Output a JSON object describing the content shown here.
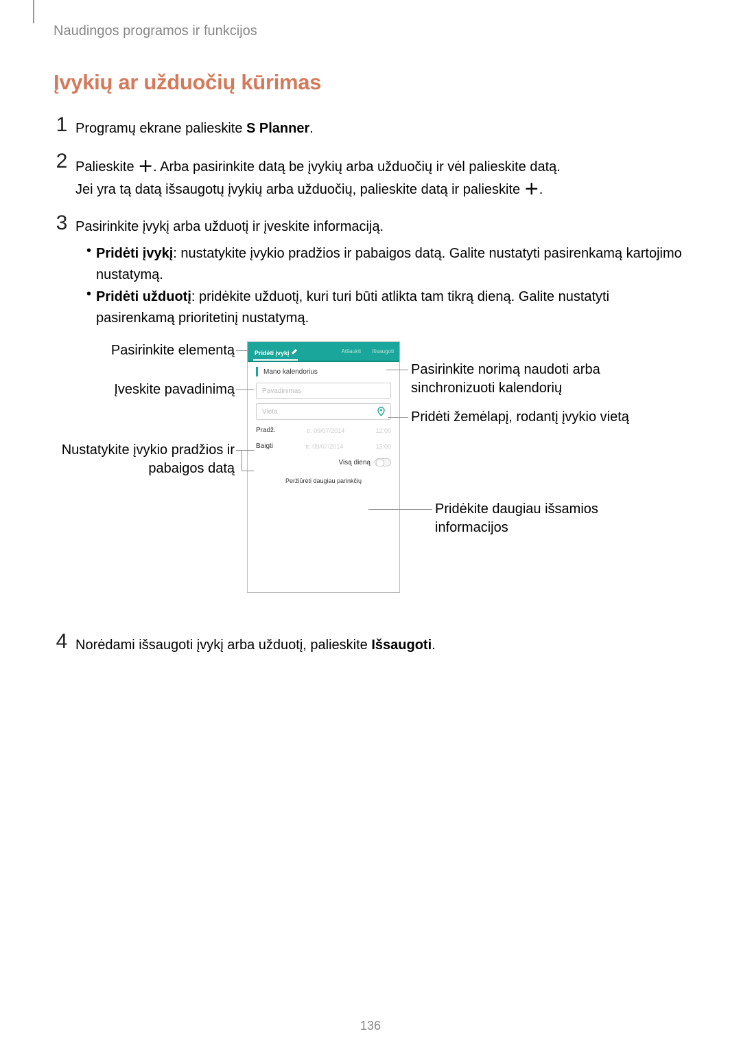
{
  "header": "Naudingos programos ir funkcijos",
  "section_title": "Įvykių ar užduočių kūrimas",
  "steps": {
    "s1_pre": "Programų ekrane palieskite ",
    "s1_bold": "S Planner",
    "s1_post": ".",
    "s2a_pre": "Palieskite ",
    "s2a_post": ". Arba pasirinkite datą be įvykių arba užduočių ir vėl palieskite datą.",
    "s2b_pre": "Jei yra tą datą išsaugotų įvykių arba užduočių, palieskite datą ir palieskite ",
    "s2b_post": ".",
    "s3": "Pasirinkite įvykį arba užduotį ir įveskite informaciją.",
    "b1_bold": "Pridėti įvykį",
    "b1_rest": ": nustatykite įvykio pradžios ir pabaigos datą. Galite nustatyti pasirenkamą kartojimo nustatymą.",
    "b2_bold": "Pridėti užduotį",
    "b2_rest": ": pridėkite užduotį, kuri turi būti atlikta tam tikrą dieną. Galite nustatyti pasirenkamą prioritetinį nustatymą.",
    "s4_pre": "Norėdami išsaugoti įvykį arba užduotį, palieskite ",
    "s4_bold": "Išsaugoti",
    "s4_post": "."
  },
  "annotations": {
    "left_select": "Pasirinkite elementą",
    "left_title": "Įveskite pavadinimą",
    "left_dates": "Nustatykite įvykio pradžios ir pabaigos datą",
    "right_cal": "Pasirinkite norimą naudoti arba sinchronizuoti kalendorių",
    "right_map": "Pridėti žemėlapį, rodantį įvykio vietą",
    "right_more": "Pridėkite daugiau išsamios informacijos"
  },
  "mock": {
    "tab_active": "Pridėti įvykį",
    "tab_cancel": "Atšaukti",
    "tab_save": "Išsaugoti",
    "cal_name": "Mano kalendorius",
    "field_name": "Pavadinimas",
    "field_loc": "Vieta",
    "row_start_label": "Pradž.",
    "row_start_date": "tr. 09/07/2014",
    "row_start_time": "12:00",
    "row_end_label": "Baigti",
    "row_end_date": "tr. 09/07/2014",
    "row_end_time": "13:00",
    "allday": "Visą dieną",
    "more": "Peržiūrėti daugiau parinkčių"
  },
  "page_num": "136"
}
